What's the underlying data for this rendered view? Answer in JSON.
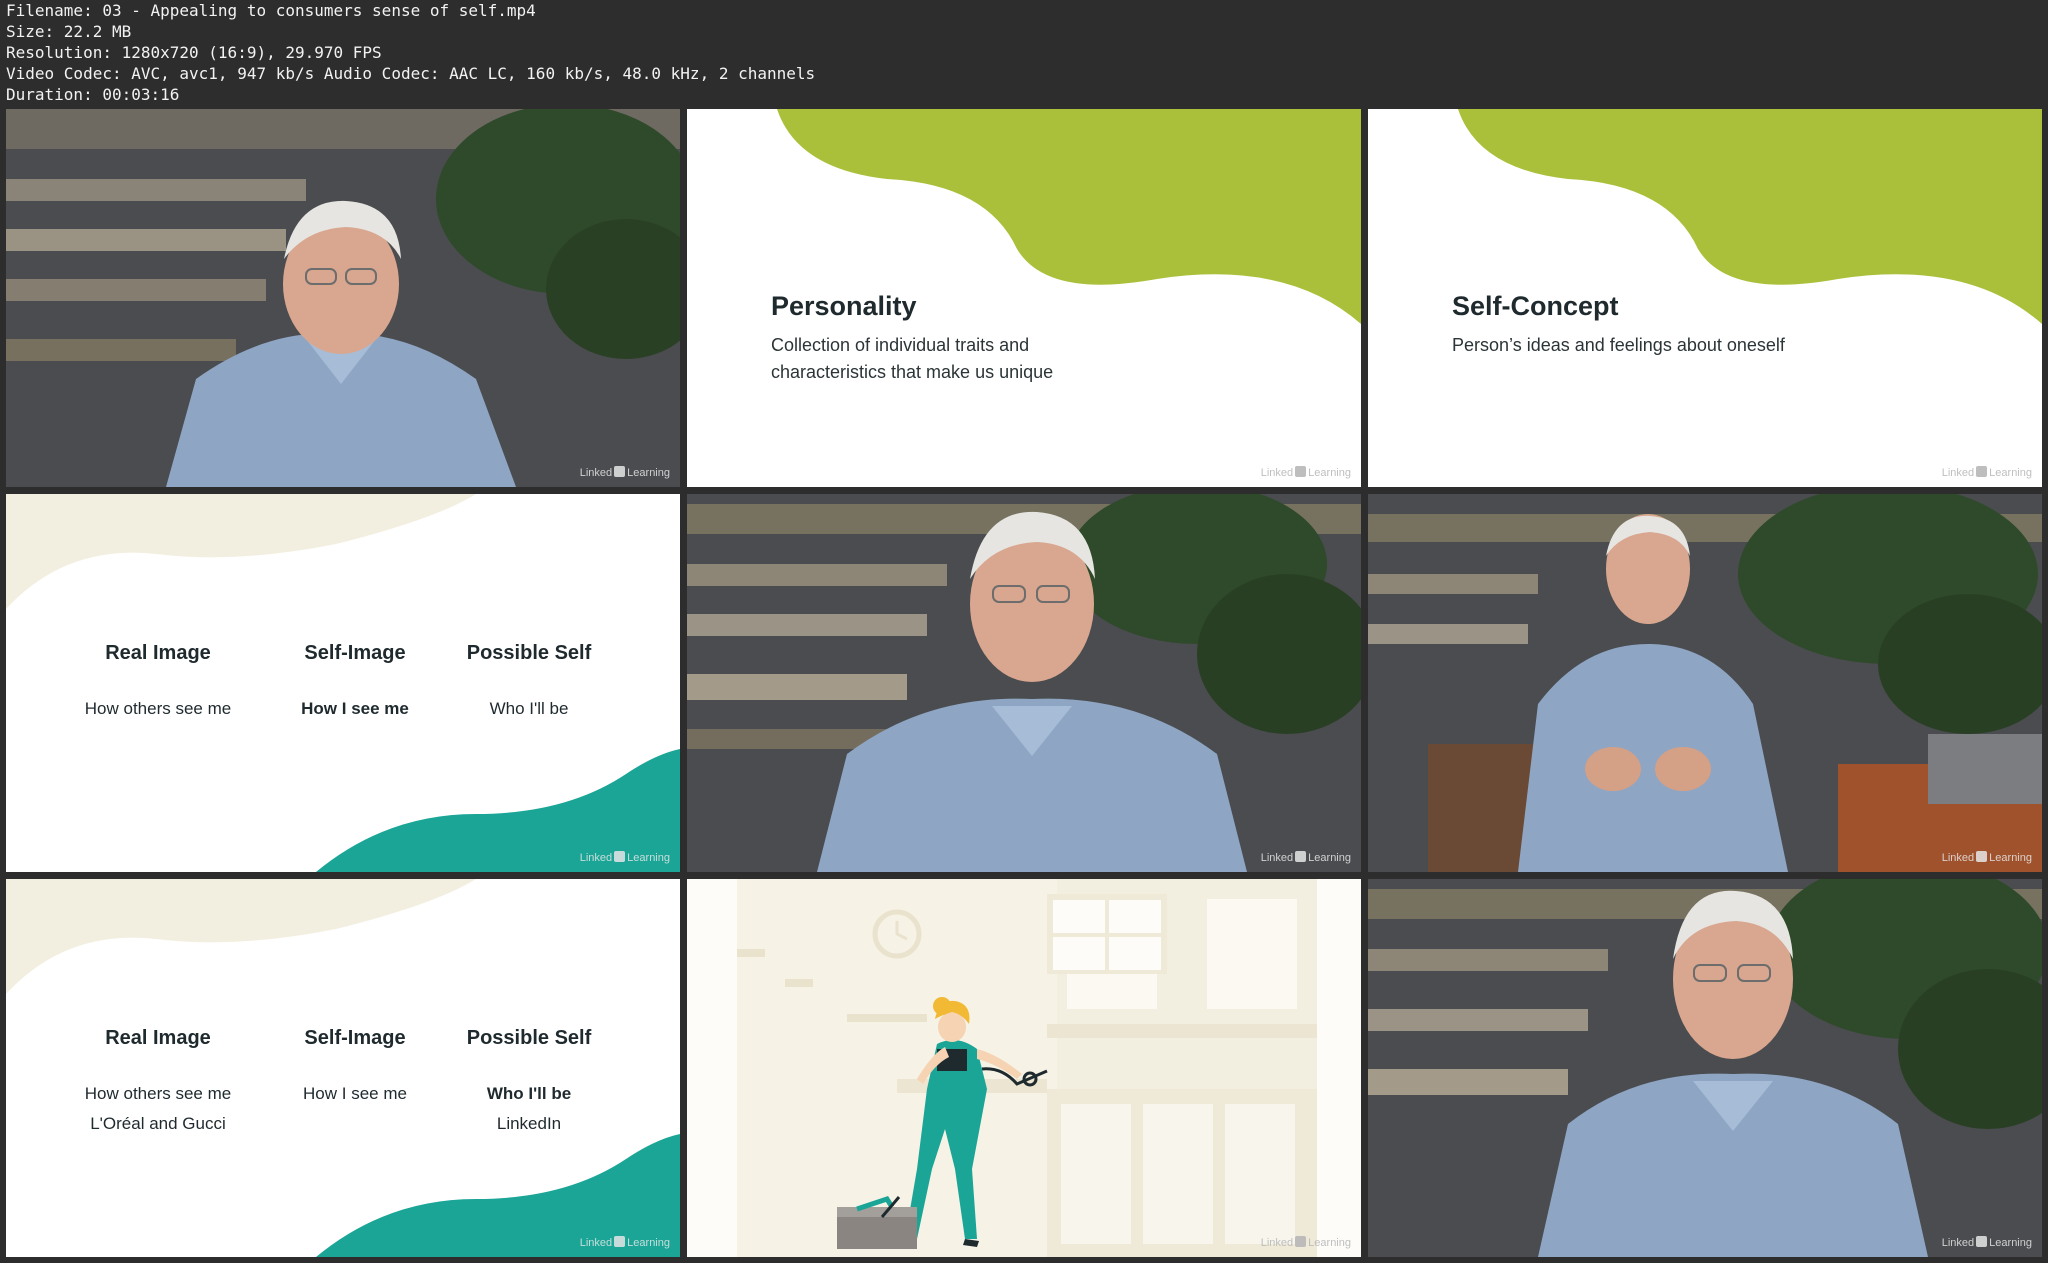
{
  "info": {
    "filename": "Filename: 03 - Appealing to consumers sense of self.mp4",
    "size": "Size: 22.2 MB",
    "resolution": "Resolution: 1280x720 (16:9), 29.970 FPS",
    "codec": "Video Codec: AVC, avc1, 947 kb/s Audio Codec: AAC LC, 160 kb/s, 48.0 kHz, 2 channels",
    "duration": "Duration: 00:03:16"
  },
  "watermark": {
    "brand_left": "Linked",
    "brand_right": "Learning"
  },
  "slides": {
    "personality": {
      "title": "Personality",
      "line1": "Collection of individual traits and",
      "line2": "characteristics that make us unique"
    },
    "self_concept": {
      "title": "Self-Concept",
      "line1": "Person’s ideas and feelings about oneself"
    },
    "images_a": {
      "col1": {
        "heading": "Real Image",
        "line1": "How others see me"
      },
      "col2": {
        "heading": "Self-Image",
        "line1": "How I see me"
      },
      "col3": {
        "heading": "Possible Self",
        "line1": "Who I'll be"
      }
    },
    "images_b": {
      "col1": {
        "heading": "Real Image",
        "line1": "How others see me",
        "line2": "L'Oréal and Gucci"
      },
      "col2": {
        "heading": "Self-Image",
        "line1": "How I see me"
      },
      "col3": {
        "heading": "Possible Self",
        "line1": "Who I'll be",
        "line2": "LinkedIn"
      }
    }
  },
  "colors": {
    "lime": "#aac03a",
    "teal": "#1aa596",
    "cream": "#f3efe0",
    "shirt": "#8ea5c4"
  }
}
